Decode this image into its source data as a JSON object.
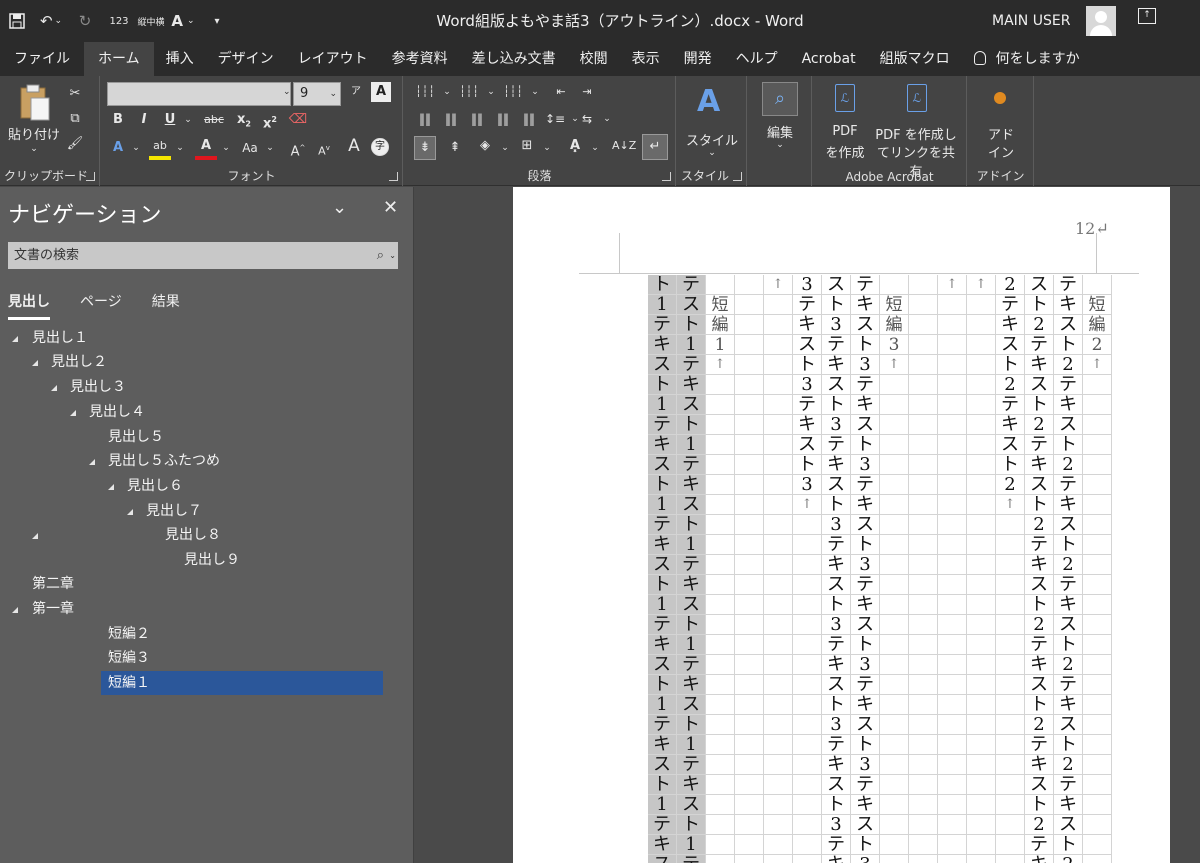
{
  "titlebar": {
    "title": "Word組版よもやま話3（アウトライン）.docx  -  Word",
    "user": "MAIN USER",
    "qat": [
      "save-icon",
      "undo-icon",
      "redo-icon",
      "123",
      "縦中横",
      "A"
    ]
  },
  "tabs": [
    "ファイル",
    "ホーム",
    "挿入",
    "デザイン",
    "レイアウト",
    "参考資料",
    "差し込み文書",
    "校閲",
    "表示",
    "開発",
    "ヘルプ",
    "Acrobat",
    "組版マクロ",
    "何をしますか"
  ],
  "ribbon": {
    "clipboard": {
      "paste": "貼り付け",
      "label": "クリップボード"
    },
    "font": {
      "name": "",
      "size": "9",
      "label": "フォント"
    },
    "paragraph": {
      "label": "段落"
    },
    "style": {
      "button": "スタイル",
      "label": "スタイル"
    },
    "editing": {
      "button": "編集"
    },
    "acrobat": {
      "create_pdf_1": "PDF",
      "create_pdf_2": "を作成",
      "share_1": "PDF を作成し",
      "share_2": "てリンクを共有",
      "label": "Adobe Acrobat"
    },
    "addin": {
      "button_1": "アド",
      "button_2": "イン",
      "label": "アドイン"
    }
  },
  "navigation": {
    "title": "ナビゲーション",
    "search_placeholder": "文書の検索",
    "tabs": [
      "見出し",
      "ページ",
      "結果"
    ],
    "items": [
      {
        "label": "見出し１"
      },
      {
        "label": "見出し２"
      },
      {
        "label": "見出し３"
      },
      {
        "label": "見出し４"
      },
      {
        "label": "見出し５"
      },
      {
        "label": "見出し５ふたつめ"
      },
      {
        "label": "見出し６"
      },
      {
        "label": "見出し７"
      },
      {
        "label": "見出し８"
      },
      {
        "label": "見出し９"
      },
      {
        "label": "第二章"
      },
      {
        "label": "第一章"
      },
      {
        "label": "短編２"
      },
      {
        "label": "短編３"
      },
      {
        "label": "短編１"
      }
    ],
    "selected": "短編１"
  },
  "document": {
    "page_number": "12↵",
    "columns": [
      {
        "chars": "ト1テキスト1テキスト1テキスト1テキスト1テキスト1テキスト1テキスト1テキス",
        "shade": true
      },
      {
        "chars": "テスト1テキスト1テキスト1テキスト1テキスト1テキスト1テキスト1テキスト1",
        "shade": true
      },
      {
        "chars": " 短編1↑",
        "shade": false,
        "label": true
      },
      {
        "chars": "",
        "shade": false
      },
      {
        "chars": "↑",
        "shade": false,
        "mark": true
      },
      {
        "chars": "3テキスト3テキスト3↑",
        "shade": false
      },
      {
        "chars": "スト3テキスト3テキスト3テキスト3テキスト3テキスト3テキスト3テキ",
        "shade": false
      },
      {
        "chars": "テキスト3テキスト3テキスト3テキスト3テキスト3テキスト3テキスト3",
        "shade": false
      },
      {
        "chars": " 短編3↑",
        "shade": false,
        "label": true
      },
      {
        "chars": "",
        "shade": false
      },
      {
        "chars": "↑",
        "shade": false,
        "mark": true
      },
      {
        "chars": "↑",
        "shade": false,
        "mark": true
      },
      {
        "chars": "2テキスト2テキスト2↑",
        "shade": false
      },
      {
        "chars": "スト2テキスト2テキスト2テキスト2テキスト2テキスト2テキスト2テキ",
        "shade": false
      },
      {
        "chars": "テキスト2テキスト2テキスト2テキスト2テキスト2テキスト2テキスト2",
        "shade": false
      },
      {
        "chars": " 短編2↑",
        "shade": false,
        "label": true
      }
    ]
  }
}
